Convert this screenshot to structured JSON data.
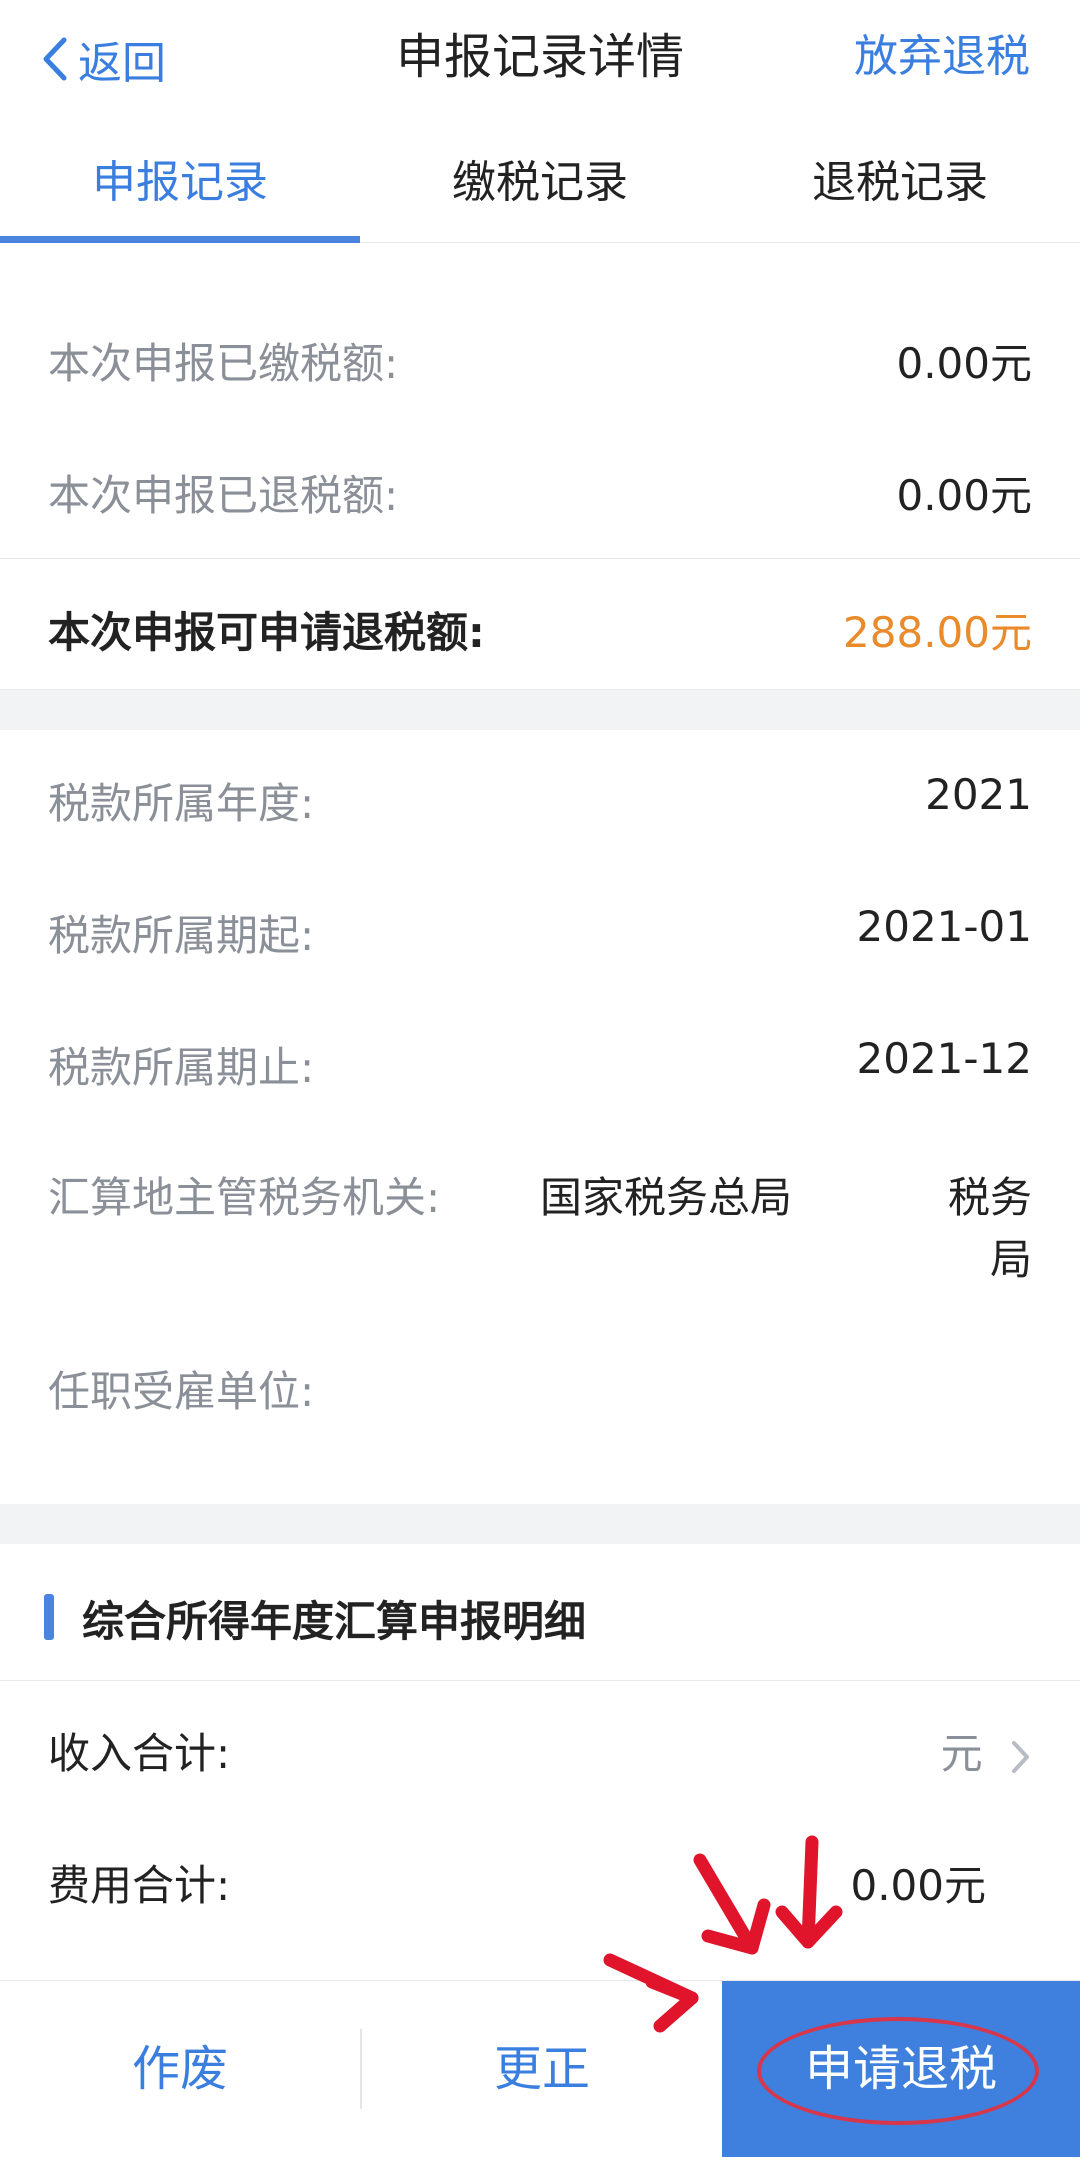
{
  "header": {
    "back_label": "返回",
    "title": "申报记录详情",
    "action_label": "放弃退税"
  },
  "tabs": [
    {
      "label": "申报记录",
      "active": true
    },
    {
      "label": "缴税记录",
      "active": false
    },
    {
      "label": "退税记录",
      "active": false
    }
  ],
  "details": {
    "paid_label": "本次申报已缴税额:",
    "paid_value": "0.00元",
    "refunded_label": "本次申报已退税额:",
    "refunded_value": "0.00元",
    "refundable_label": "本次申报可申请退税额:",
    "refundable_value": "288.00元",
    "year_label": "税款所属年度:",
    "year_value": "2021",
    "period_start_label": "税款所属期起:",
    "period_start_value": "2021-01",
    "period_end_label": "税款所属期止:",
    "period_end_value": "2021-12",
    "authority_label": "汇算地主管税务机关:",
    "authority_value_1": "国家税务总局",
    "authority_value_2": "税务",
    "authority_value_3": "局",
    "employer_label": "任职受雇单位:"
  },
  "section": {
    "title": "综合所得年度汇算申报明细",
    "income_label": "收入合计:",
    "income_value": "元",
    "expense_label": "费用合计:",
    "expense_value": "0.00元"
  },
  "bottom_bar": {
    "void_label": "作废",
    "correct_label": "更正",
    "apply_refund_label": "申请退税"
  },
  "colors": {
    "accent": "#3a7fe0",
    "highlight_value": "#e98a2b",
    "annotation_red": "#d8364a"
  }
}
